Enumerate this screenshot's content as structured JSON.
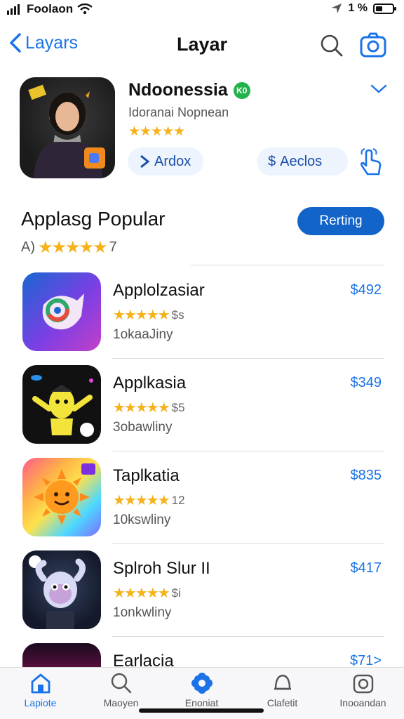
{
  "status_bar": {
    "carrier": "Foolaon",
    "battery_text": "1 %"
  },
  "nav": {
    "back_label": "Layars",
    "title": "Layar"
  },
  "featured": {
    "name": "Ndoonessia",
    "verified_badge": "K0",
    "subtitle": "Idoranai Nopnean",
    "rating_stars": "★★★★★",
    "action_left_label": "Ardox",
    "action_right_label": "Aeclos"
  },
  "section": {
    "title": "Applasg Popular",
    "rating_prefix": "A)",
    "rating_stars": "★★★★★",
    "rating_count": "7",
    "button_label": "Rerting"
  },
  "apps": [
    {
      "name": "Applolzasiar",
      "stars": "★★★★★",
      "rating_count": "$s",
      "subtitle": "1okaaJiny",
      "price": "$492"
    },
    {
      "name": "Applkasia",
      "stars": "★★★★★",
      "rating_count": "$5",
      "subtitle": "3obawliny",
      "price": "$349"
    },
    {
      "name": "Taplkatia",
      "stars": "★★★★★",
      "rating_count": "12",
      "subtitle": "10kswliny",
      "price": "$835"
    },
    {
      "name": "Splroh Slur II",
      "stars": "★★★★★",
      "rating_count": "$i",
      "subtitle": "1onkwliny",
      "price": "$417"
    },
    {
      "name": "Earlacia",
      "stars": "",
      "rating_count": "",
      "subtitle": "",
      "price": "$71>"
    }
  ],
  "tab_bar": {
    "tabs": [
      {
        "label": "Lapiote",
        "icon": "home-icon"
      },
      {
        "label": "Maoyen",
        "icon": "search-icon"
      },
      {
        "label": "Enoniat",
        "icon": "flower-icon"
      },
      {
        "label": "Clafetit",
        "icon": "bell-icon"
      },
      {
        "label": "Inooandan",
        "icon": "camera-icon"
      }
    ]
  },
  "colors": {
    "accent": "#1a73e8",
    "button_blue": "#1264c8",
    "star_gold": "#f5b21b",
    "verified_green": "#21b34a"
  }
}
